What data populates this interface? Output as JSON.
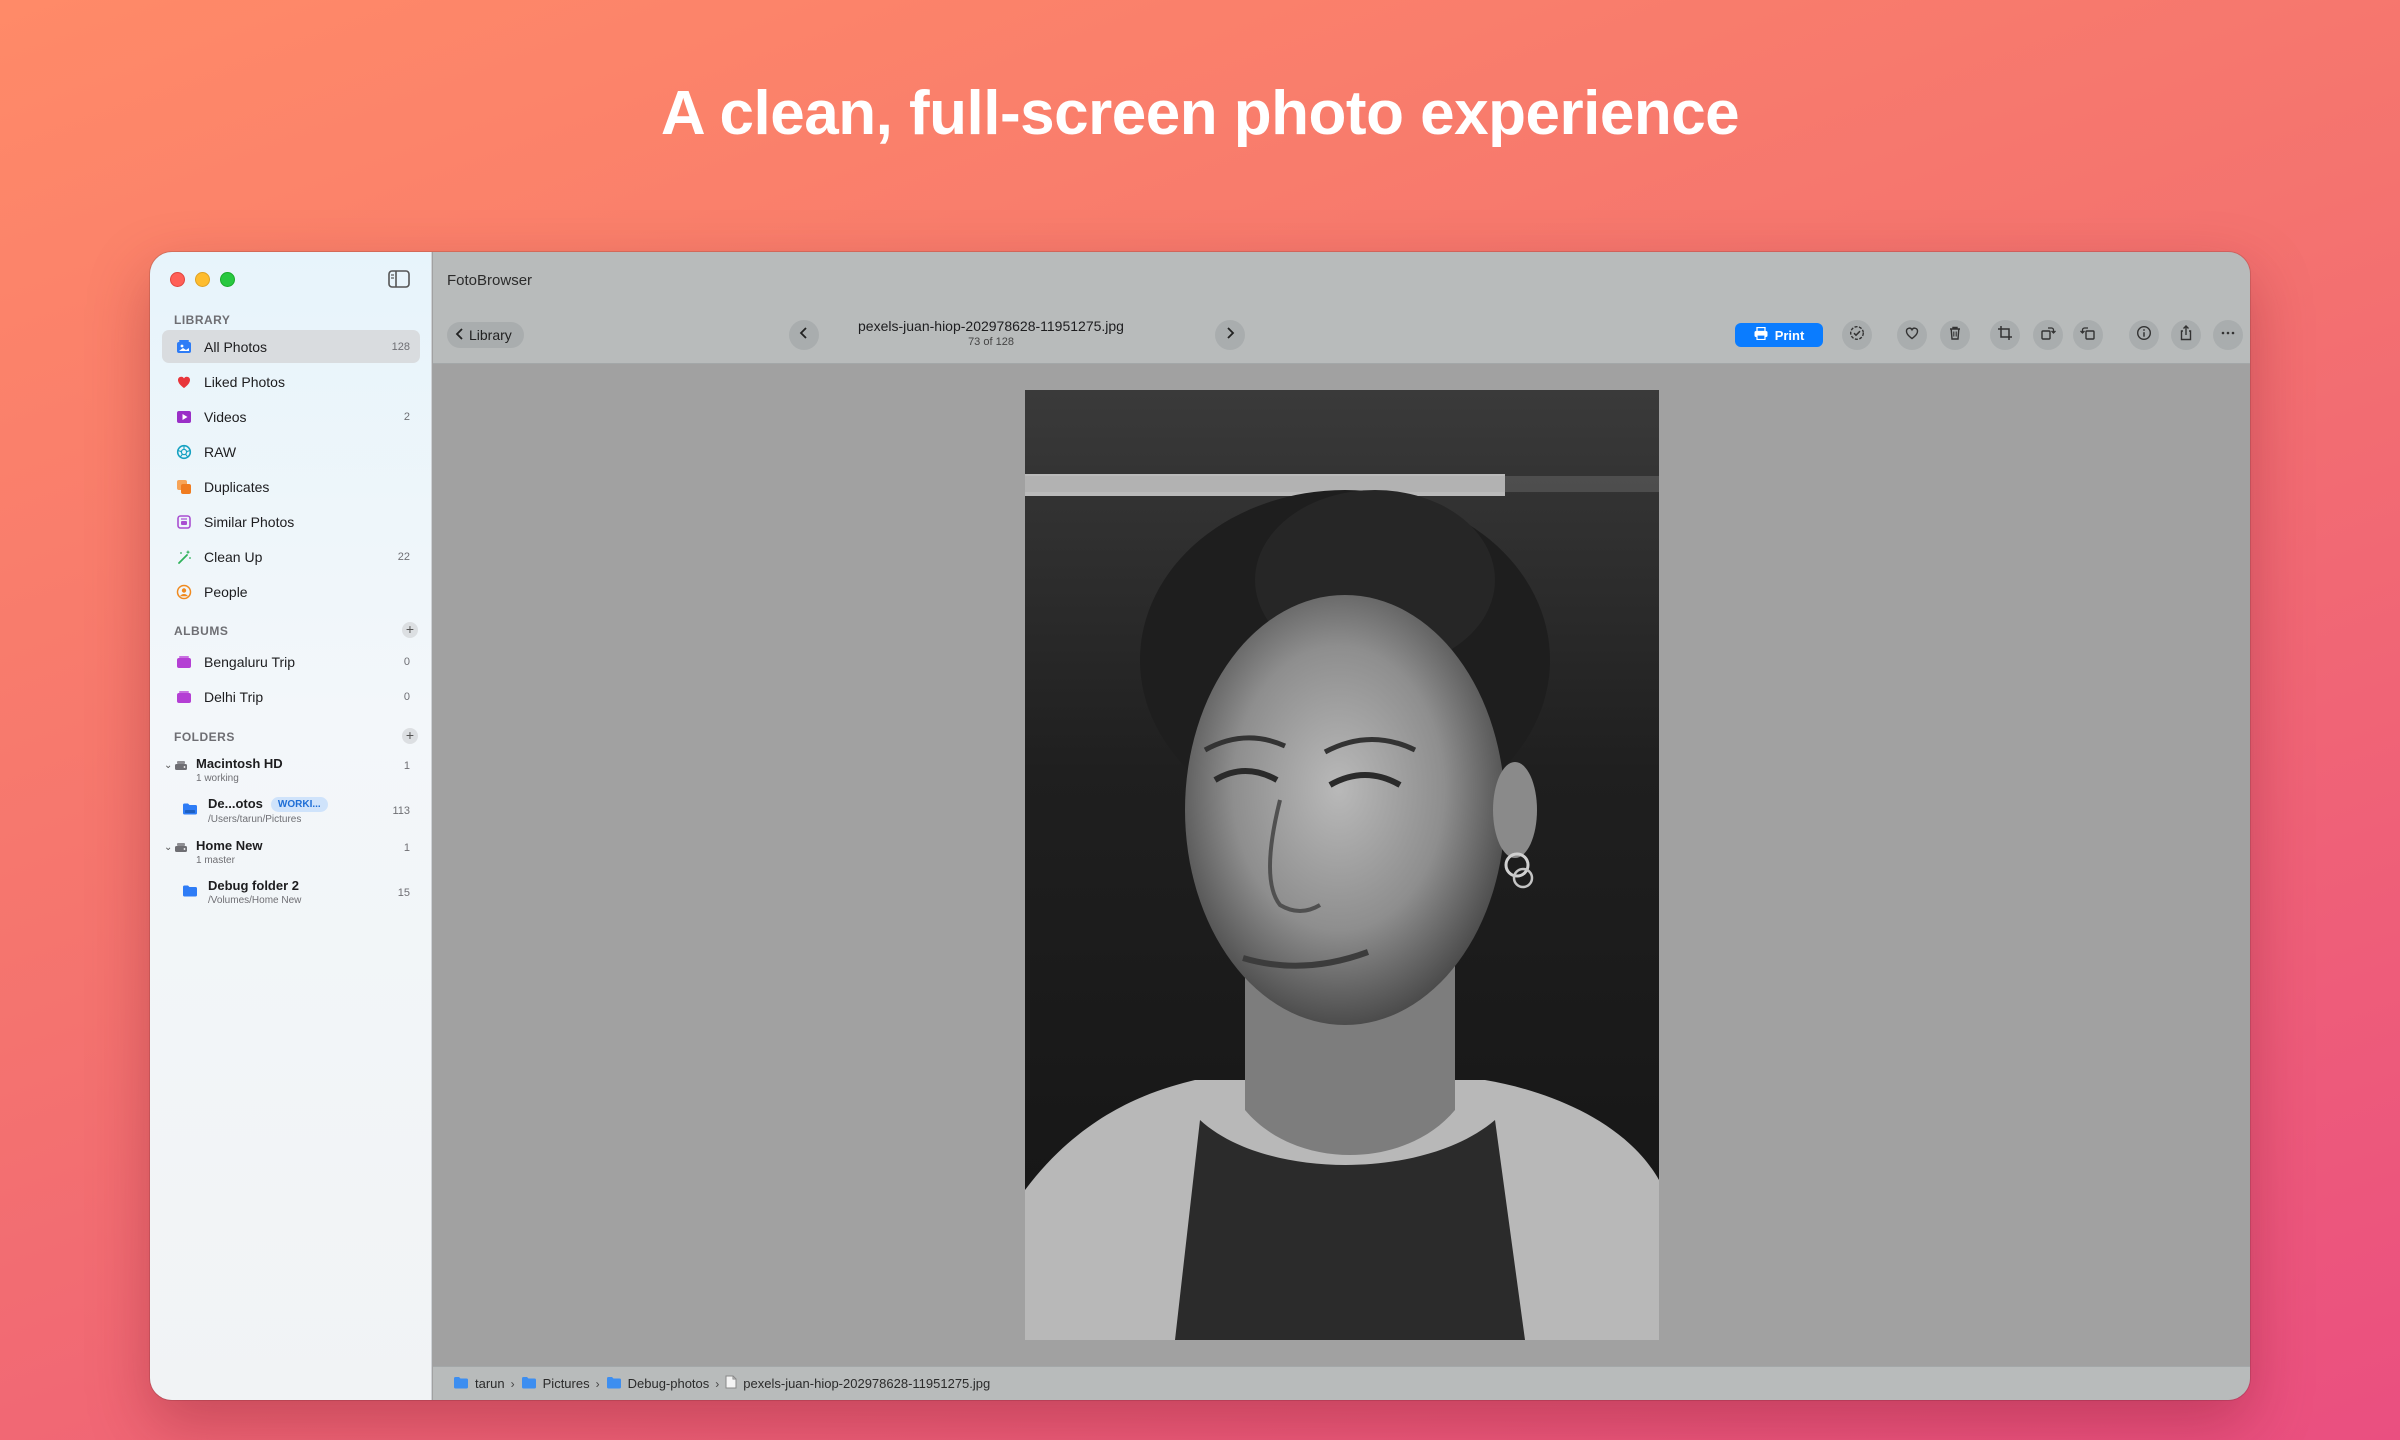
{
  "headline": "A clean, full-screen photo experience",
  "app": {
    "title": "FotoBrowser"
  },
  "sidebar": {
    "library_header": "LIBRARY",
    "library_items": [
      {
        "label": "All Photos",
        "count": "128",
        "icon": "photos-icon",
        "color": "#2e7cf6",
        "selected": true
      },
      {
        "label": "Liked Photos",
        "count": "",
        "icon": "heart-icon",
        "color": "#e8353b"
      },
      {
        "label": "Videos",
        "count": "2",
        "icon": "play-icon",
        "color": "#9a2fc7"
      },
      {
        "label": "RAW",
        "count": "",
        "icon": "aperture-icon",
        "color": "#17a2c2"
      },
      {
        "label": "Duplicates",
        "count": "",
        "icon": "duplicates-icon",
        "color": "#f07c1f"
      },
      {
        "label": "Similar Photos",
        "count": "",
        "icon": "similar-icon",
        "color": "#a94fd1"
      },
      {
        "label": "Clean Up",
        "count": "22",
        "icon": "wand-icon",
        "color": "#2fb25a"
      },
      {
        "label": "People",
        "count": "",
        "icon": "person-icon",
        "color": "#f08a1f"
      }
    ],
    "albums_header": "ALBUMS",
    "albums": [
      {
        "label": "Bengaluru Trip",
        "count": "0",
        "color": "#b43fd4"
      },
      {
        "label": "Delhi Trip",
        "count": "0",
        "color": "#b43fd4"
      }
    ],
    "folders_header": "FOLDERS",
    "folders": {
      "macintosh": {
        "name": "Macintosh HD",
        "sub": "1 working",
        "count": "1"
      },
      "debug_photos": {
        "name": "De...otos",
        "badge": "WORKI...",
        "sub": "/Users/tarun/Pictures",
        "count": "113"
      },
      "home_new": {
        "name": "Home New",
        "sub": "1 master",
        "count": "1"
      },
      "debug_folder": {
        "name": "Debug folder 2",
        "sub": "/Volumes/Home New",
        "count": "15"
      }
    }
  },
  "toolbar": {
    "back_label": "Library",
    "file_name": "pexels-juan-hiop-202978628-11951275.jpg",
    "position": "73 of 128",
    "print_label": "Print"
  },
  "statusbar": {
    "crumbs": [
      "tarun",
      "Pictures",
      "Debug-photos",
      "pexels-juan-hiop-202978628-11951275.jpg"
    ]
  },
  "colors": {
    "accent": "#0a7cff",
    "viewer_bg": "#a1a1a1",
    "toolbar_bg": "#b8bbbb",
    "folder_blue": "#2e7cf6"
  }
}
